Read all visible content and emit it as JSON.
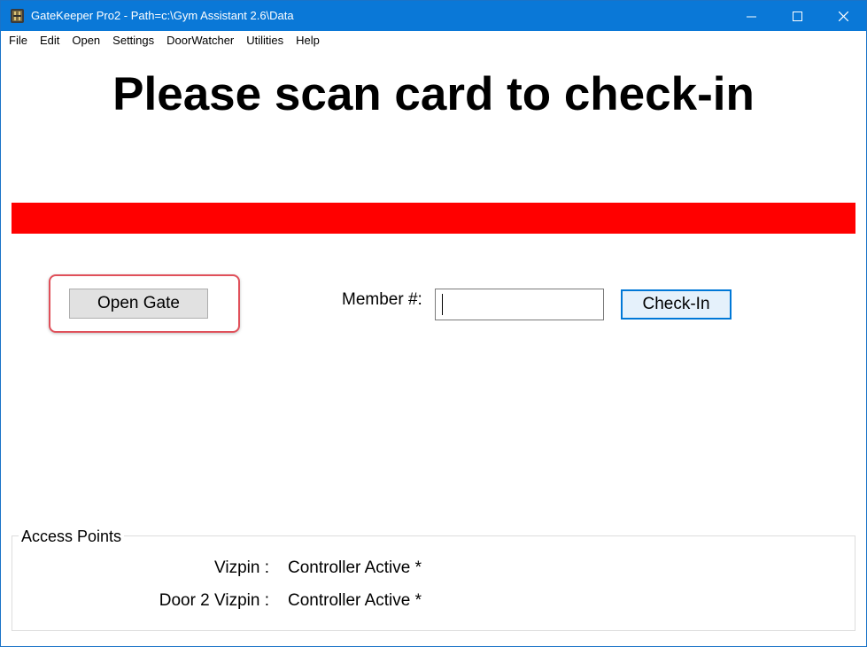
{
  "window": {
    "title": "GateKeeper Pro2 - Path=c:\\Gym Assistant 2.6\\Data",
    "icon": "gatekeeper-app-icon",
    "titlebar_color": "#0a78d7"
  },
  "menu": {
    "items": [
      "File",
      "Edit",
      "Open",
      "Settings",
      "DoorWatcher",
      "Utilities",
      "Help"
    ]
  },
  "main": {
    "heading": "Please scan card to check-in",
    "status_color": "#ff0000",
    "open_gate_label": "Open Gate",
    "member_label": "Member #:",
    "member_value": "",
    "checkin_label": "Check-In"
  },
  "access_points": {
    "legend": "Access Points",
    "rows": [
      {
        "label": "Vizpin :",
        "status": "Controller Active *"
      },
      {
        "label": "Door 2 Vizpin :",
        "status": "Controller Active *"
      }
    ]
  },
  "highlight_color": "#e0505a"
}
